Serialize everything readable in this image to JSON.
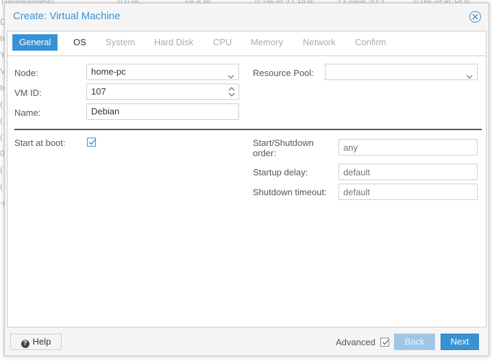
{
  "background": {
    "row": [
      "Haraquroiaba)",
      "0.0 %",
      "58.8 %",
      "0.1% of 2 CPUs",
      "13 days 20:3",
      "0.0% of 8CPUs"
    ],
    "left_glyphs": [
      "D",
      "te",
      "Y",
      "V",
      "te",
      "(",
      "(",
      "(",
      "0",
      "(",
      "(",
      "-("
    ]
  },
  "dialog": {
    "title": "Create: Virtual Machine",
    "close_icon": "close-circle-icon"
  },
  "tabs": [
    {
      "label": "General",
      "state": "active"
    },
    {
      "label": "OS",
      "state": "enabled"
    },
    {
      "label": "System",
      "state": "disabled"
    },
    {
      "label": "Hard Disk",
      "state": "disabled"
    },
    {
      "label": "CPU",
      "state": "disabled"
    },
    {
      "label": "Memory",
      "state": "disabled"
    },
    {
      "label": "Network",
      "state": "disabled"
    },
    {
      "label": "Confirm",
      "state": "disabled"
    }
  ],
  "form": {
    "node": {
      "label": "Node:",
      "value": "home-pc"
    },
    "vmid": {
      "label": "VM ID:",
      "value": "107"
    },
    "name": {
      "label": "Name:",
      "value": "Debian"
    },
    "resource_pool": {
      "label": "Resource Pool:",
      "value": ""
    },
    "start_at_boot": {
      "label": "Start at boot:",
      "checked": true
    },
    "startup_order": {
      "label_line1": "Start/Shutdown",
      "label_line2": "order:",
      "placeholder": "any"
    },
    "startup_delay": {
      "label": "Startup delay:",
      "placeholder": "default"
    },
    "shutdown_timeout": {
      "label": "Shutdown timeout:",
      "placeholder": "default"
    }
  },
  "footer": {
    "help_label": "Help",
    "help_icon": "question-circle-icon",
    "advanced_label": "Advanced",
    "advanced_checked": true,
    "back_label": "Back",
    "next_label": "Next"
  },
  "colors": {
    "accent": "#3892d4",
    "disabled_button": "#9fc6e6"
  }
}
